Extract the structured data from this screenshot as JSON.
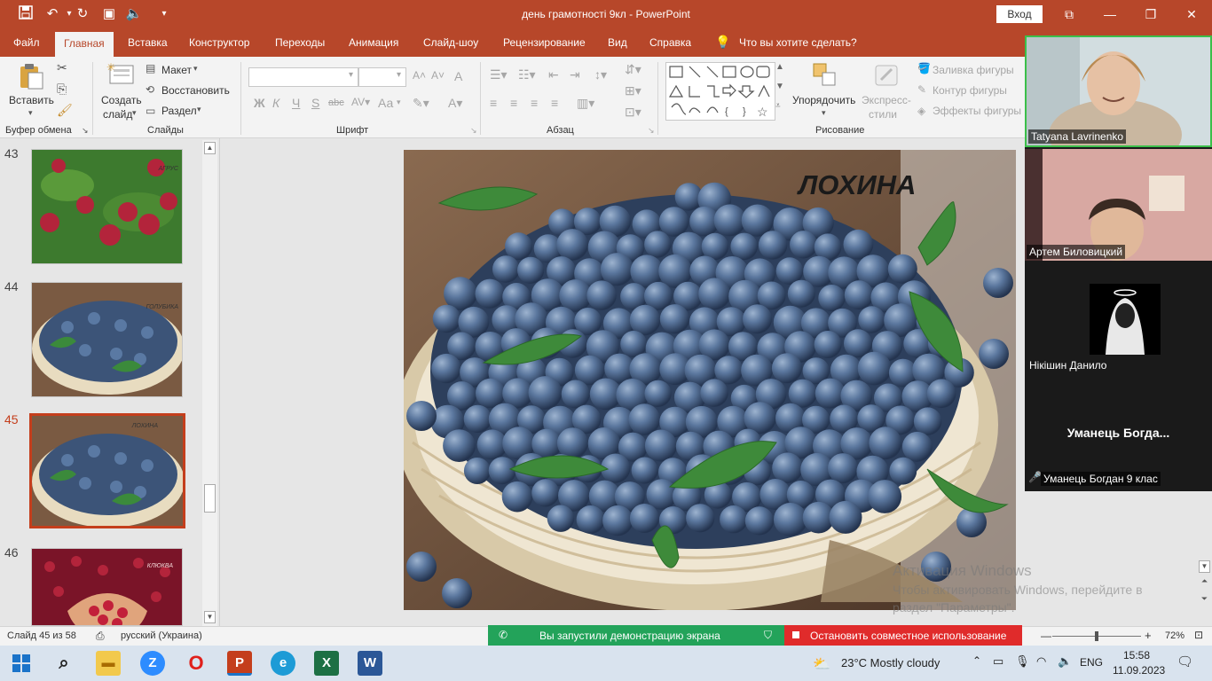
{
  "titlebar": {
    "doc_title": "день грамотності 9кл  -  PowerPoint",
    "signin": "Вход",
    "save_icon": "save-icon",
    "undo_icon": "undo-icon",
    "redo_icon": "redo-icon"
  },
  "tabs": [
    "Файл",
    "Главная",
    "Вставка",
    "Конструктор",
    "Переходы",
    "Анимация",
    "Слайд-шоу",
    "Рецензирование",
    "Вид",
    "Справка"
  ],
  "tell_me": "Что вы хотите сделать?",
  "ribbon": {
    "paste": "Вставить",
    "clipboard_group": "Буфер обмена",
    "new_slide_line1": "Создать",
    "new_slide_line2": "слайд",
    "layout": "Макет",
    "reset": "Восстановить",
    "section": "Раздел",
    "slides_group": "Слайды",
    "font_group": "Шрифт",
    "bold": "Ж",
    "italic": "К",
    "underline": "Ч",
    "strike": "S",
    "abc": "abc",
    "aa": "Аа",
    "paragraph_group": "Абзац",
    "arrange_line1": "Упорядочить",
    "quick_styles_line1": "Экспресс-",
    "quick_styles_line2": "стили",
    "shape_fill": "Заливка фигуры",
    "shape_outline": "Контур фигуры",
    "shape_effects": "Эффекты фигуры",
    "drawing_group": "Рисование"
  },
  "thumbnails": [
    {
      "num": "43",
      "caption": "АГРУС"
    },
    {
      "num": "44",
      "caption": "ГОЛУБИКА"
    },
    {
      "num": "45",
      "caption": "ЛОХИНА"
    },
    {
      "num": "46",
      "caption": "КЛЮКВА"
    }
  ],
  "slide": {
    "title": "ЛОХИНА"
  },
  "video": {
    "p1": "Tatyana Lavrinenko",
    "p2": "Артем Биловицкий",
    "p3": "Нікішин Данило",
    "p4_center": "Уманець  Богда...",
    "p4": "Уманець Богдан 9 клас"
  },
  "watermark": {
    "line1": "Активация Windows",
    "line2": "Чтобы активировать Windows, перейдите в",
    "line3": "раздел \"Параметры\"."
  },
  "status": {
    "slide_of": "Слайд 45 из 58",
    "language": "русский (Украина)",
    "zoom": "72%",
    "zoom_level": 0.5
  },
  "share": {
    "green": "Вы запустили демонстрацию экрана",
    "red": "Остановить совместное использование"
  },
  "taskbar": {
    "weather": "23°C  Mostly cloudy",
    "lang": "ENG",
    "time": "15:58",
    "date": "11.09.2023"
  },
  "colors": {
    "accent": "#b7472a",
    "share_green": "#23a35a",
    "share_red": "#e02b2b"
  }
}
